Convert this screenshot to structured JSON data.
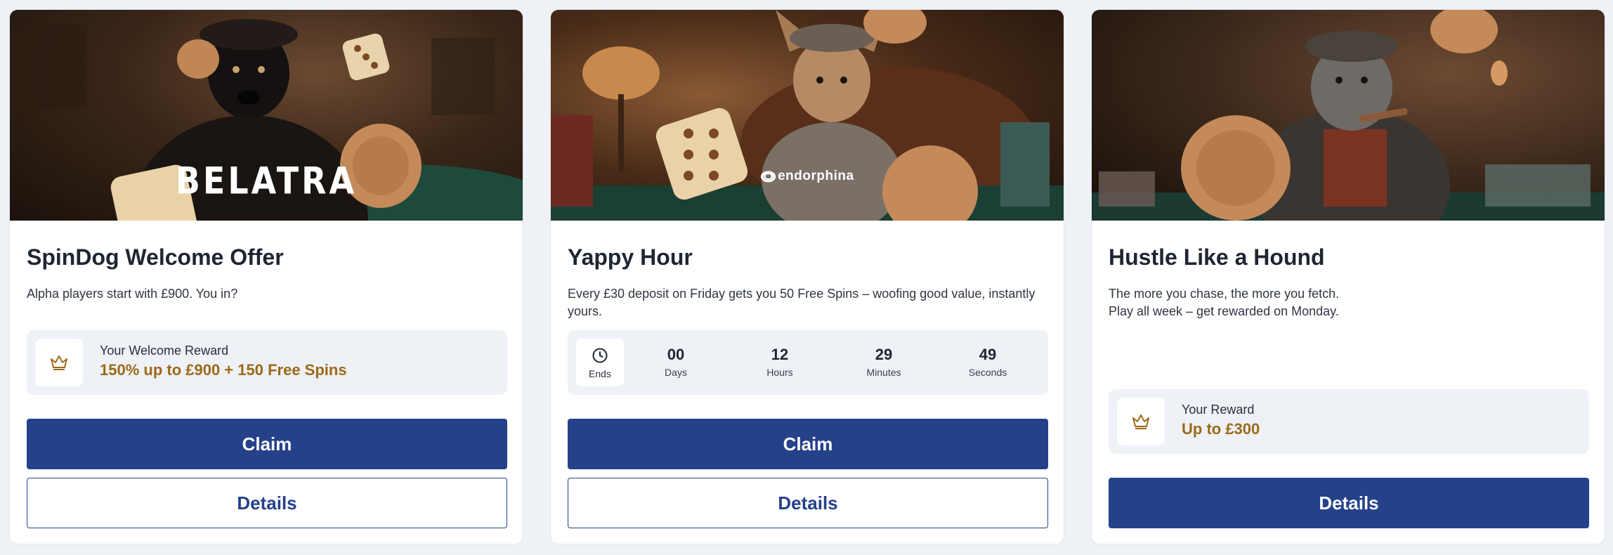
{
  "colors": {
    "primary_button": "#24418a",
    "reward_value": "#9b6a17",
    "panel_bg": "#eef1f6"
  },
  "cards": [
    {
      "brand": "BELATRA",
      "title": "SpinDog Welcome Offer",
      "description": "Alpha players start with £900. You in?",
      "reward": {
        "icon": "crown-icon",
        "label": "Your Welcome Reward",
        "value": "150% up to £900 + 150 Free Spins"
      },
      "claim_label": "Claim",
      "details_label": "Details"
    },
    {
      "brand": "endorphina",
      "title": "Yappy Hour",
      "description": "Every £30 deposit on Friday gets you 50 Free Spins – woofing good value, instantly yours.",
      "timer": {
        "icon": "clock-icon",
        "ends_label": "Ends",
        "days": "00",
        "days_label": "Days",
        "hours": "12",
        "hours_label": "Hours",
        "minutes": "29",
        "minutes_label": "Minutes",
        "seconds": "49",
        "seconds_label": "Seconds"
      },
      "claim_label": "Claim",
      "details_label": "Details"
    },
    {
      "title": "Hustle Like a Hound",
      "description_line1": "The more you chase, the more you fetch.",
      "description_line2": "Play all week – get rewarded on Monday.",
      "reward": {
        "icon": "crown-icon",
        "label": "Your Reward",
        "value": "Up to £300"
      },
      "details_label": "Details"
    }
  ]
}
